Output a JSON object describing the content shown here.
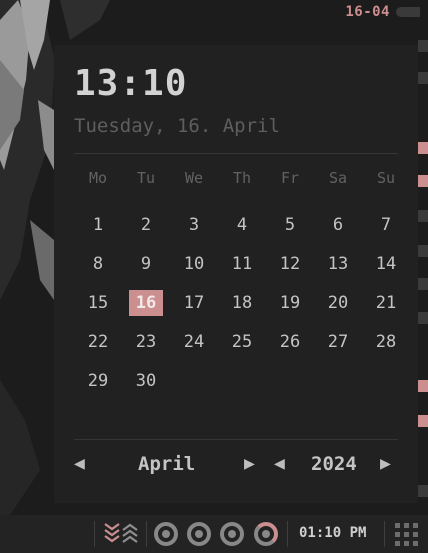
{
  "topbar": {
    "date_tag": "16-04"
  },
  "clock": {
    "time": "13:10",
    "date_line": "Tuesday, 16. April"
  },
  "calendar": {
    "weekdays": [
      "Mo",
      "Tu",
      "We",
      "Th",
      "Fr",
      "Sa",
      "Su"
    ],
    "weeks": [
      [
        "1",
        "2",
        "3",
        "4",
        "5",
        "6",
        "7"
      ],
      [
        "8",
        "9",
        "10",
        "11",
        "12",
        "13",
        "14"
      ],
      [
        "15",
        "16",
        "17",
        "18",
        "19",
        "20",
        "21"
      ],
      [
        "22",
        "23",
        "24",
        "25",
        "26",
        "27",
        "28"
      ],
      [
        "29",
        "30"
      ]
    ],
    "today": "16",
    "month": "April",
    "year": "2024",
    "prev_glyph": "◀",
    "next_glyph": "▶"
  },
  "bottombar": {
    "time": "01:10 PM"
  },
  "colors": {
    "accent": "#cc8f8f",
    "panel": "#212121",
    "background": "#1a1a1a"
  }
}
